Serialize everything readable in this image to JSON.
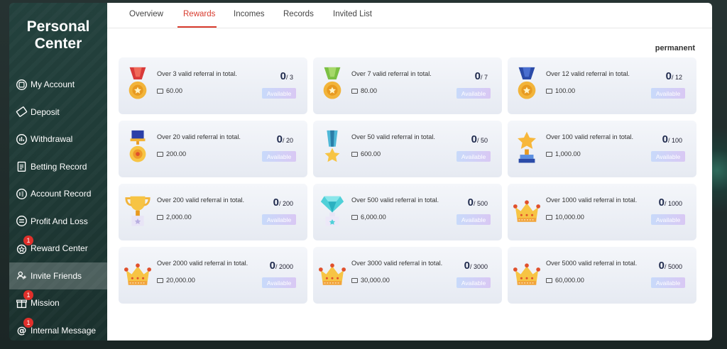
{
  "sidebar": {
    "title_line1": "Personal",
    "title_line2": "Center",
    "items": [
      {
        "label": "My Account",
        "icon": "account-icon",
        "badge": ""
      },
      {
        "label": "Deposit",
        "icon": "deposit-icon",
        "badge": ""
      },
      {
        "label": "Withdrawal",
        "icon": "withdrawal-icon",
        "badge": ""
      },
      {
        "label": "Betting Record",
        "icon": "betting-record-icon",
        "badge": ""
      },
      {
        "label": "Account Record",
        "icon": "account-record-icon",
        "badge": ""
      },
      {
        "label": "Profit And Loss",
        "icon": "profit-loss-icon",
        "badge": ""
      },
      {
        "label": "Reward Center",
        "icon": "reward-center-icon",
        "badge": "1"
      },
      {
        "label": "Invite Friends",
        "icon": "invite-friends-icon",
        "badge": "",
        "active": true
      },
      {
        "label": "Mission",
        "icon": "gift-icon",
        "badge": "1"
      },
      {
        "label": "Internal Message",
        "icon": "at-icon",
        "badge": "1"
      }
    ]
  },
  "tabs": [
    "Overview",
    "Rewards",
    "Incomes",
    "Records",
    "Invited List"
  ],
  "active_tab": "Rewards",
  "permanent_label": "permanent",
  "rewards": [
    {
      "desc": "Over 3 valid referral in total.",
      "amount": "60.00",
      "done": "0",
      "target": "/ 3",
      "button": "Available",
      "icon": "red-medal-icon"
    },
    {
      "desc": "Over 7 valid referral in total.",
      "amount": "80.00",
      "done": "0",
      "target": "/ 7",
      "button": "Available",
      "icon": "green-medal-icon"
    },
    {
      "desc": "Over 12 valid referral in total.",
      "amount": "100.00",
      "done": "0",
      "target": "/ 12",
      "button": "Available",
      "icon": "blue-medal-icon"
    },
    {
      "desc": "Over 20 valid referral in total.",
      "amount": "200.00",
      "done": "0",
      "target": "/ 20",
      "button": "Available",
      "icon": "navy-medal-icon"
    },
    {
      "desc": "Over 50 valid referral in total.",
      "amount": "600.00",
      "done": "0",
      "target": "/ 50",
      "button": "Available",
      "icon": "star-medal-icon"
    },
    {
      "desc": "Over 100 valid referral in total.",
      "amount": "1,000.00",
      "done": "0",
      "target": "/ 100",
      "button": "Available",
      "icon": "star-trophy-icon"
    },
    {
      "desc": "Over 200 valid referral in total.",
      "amount": "2,000.00",
      "done": "0",
      "target": "/ 200",
      "button": "Available",
      "icon": "gold-cup-icon"
    },
    {
      "desc": "Over 500 valid referral in total.",
      "amount": "6,000.00",
      "done": "0",
      "target": "/ 500",
      "button": "Available",
      "icon": "diamond-trophy-icon"
    },
    {
      "desc": "Over 1000 valid referral in total.",
      "amount": "10,000.00",
      "done": "0",
      "target": "/ 1000",
      "button": "Available",
      "icon": "crown-icon"
    },
    {
      "desc": "Over 2000 valid referral in total.",
      "amount": "20,000.00",
      "done": "0",
      "target": "/ 2000",
      "button": "Available",
      "icon": "crown-icon"
    },
    {
      "desc": "Over 3000 valid referral in total.",
      "amount": "30,000.00",
      "done": "0",
      "target": "/ 3000",
      "button": "Available",
      "icon": "crown-icon"
    },
    {
      "desc": "Over 5000 valid referral in total.",
      "amount": "60,000.00",
      "done": "0",
      "target": "/ 5000",
      "button": "Available",
      "icon": "crown-icon"
    }
  ]
}
